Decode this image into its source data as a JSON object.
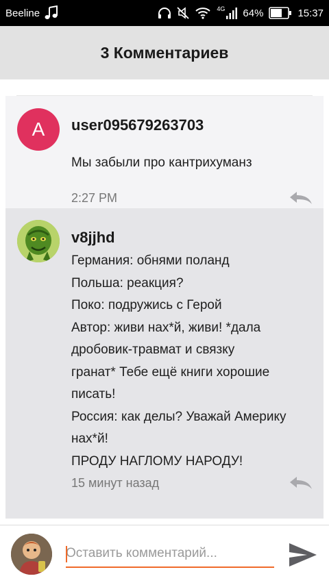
{
  "status_bar": {
    "carrier": "Beeline",
    "network": "4G",
    "battery": "64%",
    "time": "15:37",
    "icons": [
      "music-note-icon",
      "headphones-icon",
      "mute-icon",
      "wifi-icon",
      "signal-icon",
      "battery-icon"
    ]
  },
  "header": {
    "title": "3 Комментариев"
  },
  "comments": [
    {
      "avatar_letter": "A",
      "avatar_color": "#e0315e",
      "username": "user095679263703",
      "text": "Мы забыли про кантрихуманз",
      "time": "2:27 PM",
      "reply_icon": "reply-icon"
    },
    {
      "avatar_icon": "grinch-avatar",
      "username": "v8jjhd",
      "text": "Германия: обнями поланд\nПольша: реакция?\nПоко: подружись с Герой\nАвтор: живи нах*й, живи! *дала\nдробовик-травмат и связку\nгранат* Тебе ещё книги хорошие\nписать!\nРоссия: как делы? Уважай Америку\nнах*й!\nПРОДУ НАГЛОМУ НАРОДУ!",
      "time": "15 минут назад",
      "reply_icon": "reply-icon"
    }
  ],
  "composer": {
    "placeholder": "Оставить комментарий...",
    "value": "",
    "accent": "#f06a29",
    "send_icon": "send-icon"
  }
}
